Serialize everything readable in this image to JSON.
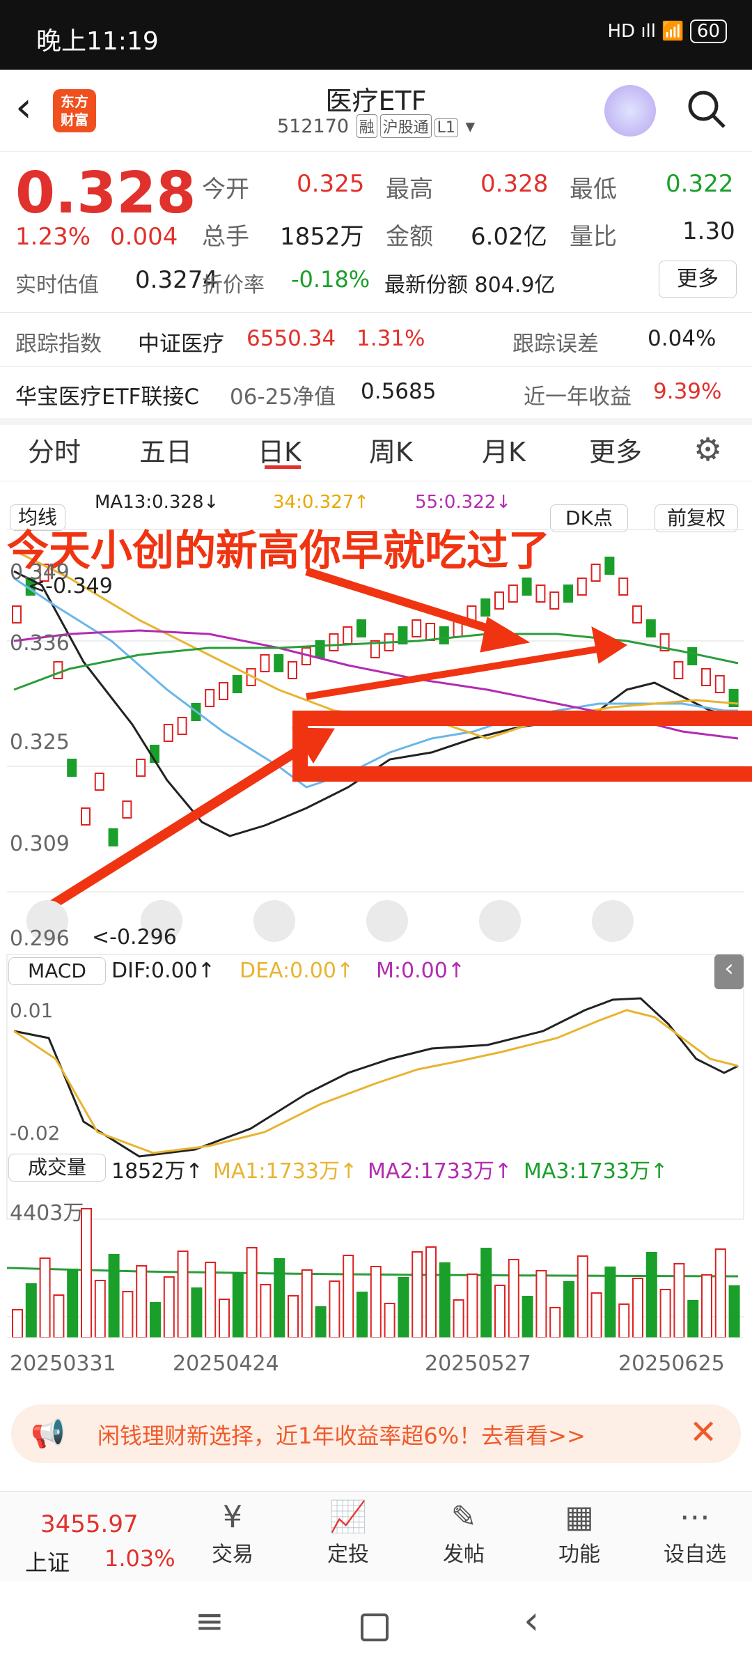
{
  "status": {
    "time": "晚上11:19",
    "battery": "60",
    "icons": "HD ıll 📶"
  },
  "header": {
    "logo": "东方\n财富",
    "title": "医疗ETF",
    "code": "512170",
    "tags": [
      "融",
      "沪股通",
      "L1"
    ]
  },
  "quote": {
    "price": "0.328",
    "pct": "1.23%",
    "chg": "0.004",
    "labels": {
      "open": "今开",
      "high": "最高",
      "low": "最低",
      "vol": "总手",
      "amt": "金额",
      "vr": "量比",
      "est": "实时估值",
      "prem": "折价率",
      "share": "最新份额 804.9亿"
    },
    "open": "0.325",
    "high": "0.328",
    "low": "0.322",
    "vol": "1852万",
    "amt": "6.02亿",
    "vr": "1.30",
    "est": "0.3274",
    "prem": "-0.18%",
    "more": "更多"
  },
  "track": {
    "label": "跟踪指数",
    "name": "中证医疗",
    "val": "6550.34",
    "pct": "1.31%",
    "err_label": "跟踪误差",
    "err": "0.04%"
  },
  "fund": {
    "name": "华宝医疗ETF联接C",
    "date": "06-25净值",
    "nav": "0.5685",
    "ret_label": "近一年收益",
    "ret": "9.39%"
  },
  "tabs": [
    "分时",
    "五日",
    "日K",
    "周K",
    "月K",
    "更多"
  ],
  "kline": {
    "ma_type": "均线",
    "ma13": "MA13:0.328↓",
    "ma34": "34:0.327↑",
    "ma55": "55:0.322↓",
    "dk": "DK点",
    "adj": "前复权",
    "overlay": "今天小创的新高你早就吃过了",
    "ticks": [
      "0.349",
      "0.336",
      "0.325",
      "0.309",
      "0.296"
    ],
    "hi_note": "<-0.349",
    "lo_note": "<-0.296",
    "colors": {
      "up": "#d22",
      "down": "#1a9f2a",
      "arrow": "#f03412"
    }
  },
  "macd": {
    "label": "MACD",
    "dif": "DIF:0.00↑",
    "dea": "DEA:0.00↑",
    "m": "M:0.00↑",
    "top": "0.01",
    "bot": "-0.02"
  },
  "volume": {
    "label": "成交量",
    "cur": "1852万↑",
    "ma1": "MA1:1733万↑",
    "ma2": "MA2:1733万↑",
    "ma3": "MA3:1733万↑",
    "max": "4403万",
    "dates": [
      "20250331",
      "20250424",
      "20250527",
      "20250625"
    ]
  },
  "banner": {
    "text": "闲钱理财新选择，近1年收益率超6%！去看看>>"
  },
  "bottom": {
    "index_val": "3455.97",
    "index_name": "上证",
    "index_pct": "1.03%",
    "items": [
      "交易",
      "定投",
      "发帖",
      "功能",
      "设自选"
    ]
  }
}
